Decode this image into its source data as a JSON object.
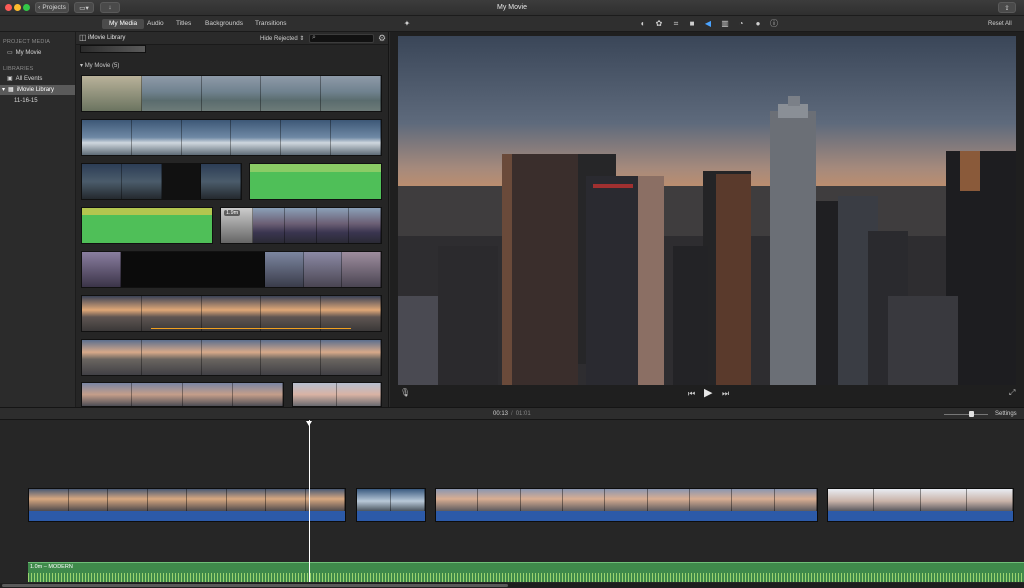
{
  "window": {
    "title": "My Movie",
    "projects_label": "Projects"
  },
  "media_tabs": [
    "My Media",
    "Audio",
    "Titles",
    "Backgrounds",
    "Transitions"
  ],
  "toolbar": {
    "reset_all": "Reset All"
  },
  "sidebar": {
    "project_media_heading": "PROJECT MEDIA",
    "project_item": "My Movie",
    "libraries_heading": "LIBRARIES",
    "all_events": "All Events",
    "library": "iMovie Library",
    "event": "11-16-15"
  },
  "browser": {
    "title": "iMovie Library",
    "filter": "Hide Rejected",
    "search_placeholder": "",
    "group_label": "My Movie",
    "group_count": "(5)",
    "clip_duration_badge": "1.9m"
  },
  "playback": {
    "current_time": "00:13",
    "separator": "/",
    "total_time": "01:01",
    "settings": "Settings"
  },
  "timeline": {
    "music_label": "1.0m – MODERN"
  },
  "icons": [
    "import-icon",
    "share-icon",
    "magic-wand-icon",
    "color-balance-icon",
    "color-correction-icon",
    "crop-icon",
    "stabilization-icon",
    "volume-icon",
    "noise-reduction-icon",
    "speed-icon",
    "filter-icon",
    "info-icon",
    "microphone-icon",
    "previous-icon",
    "play-icon",
    "next-icon",
    "fullscreen-icon",
    "gear-icon",
    "search-icon",
    "sidebar-toggle-icon"
  ],
  "colors": {
    "selection": "#5a5a5a",
    "audio_track": "#2c5aa8",
    "music_track": "#3f8a4b",
    "playhead": "#ffffff",
    "range_select": "#f0a020"
  }
}
